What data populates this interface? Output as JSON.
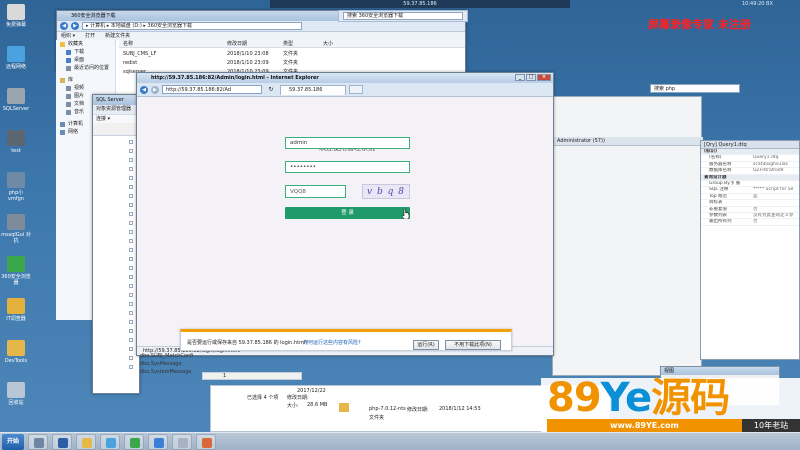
{
  "desktop": {
    "top_title": "59.37.85.186",
    "top_right": "10:49:20 BX",
    "watermark": "屏幕录像专家 未注册",
    "icons": [
      {
        "label": "免费弹幕",
        "color": "#d9d9d9"
      },
      {
        "label": "远程网络",
        "color": "#4aa3df"
      },
      {
        "label": "SQLServer",
        "color": "#9aa4ae"
      },
      {
        "label": "test",
        "color": "#5c6670"
      },
      {
        "label": "php小vmfgn",
        "color": "#6e8aa7"
      },
      {
        "label": "mssqlGui 对抗",
        "color": "#7c8c9b"
      },
      {
        "label": "360安全浏览器",
        "color": "#3aa84a"
      },
      {
        "label": "IT调查器",
        "color": "#e3b23c"
      },
      {
        "label": "DevTools",
        "color": "#e5b649"
      },
      {
        "label": "回收站",
        "color": "#b8c6d6"
      }
    ]
  },
  "explorer": {
    "title": "360安全浏览器下载",
    "address": "▸ 计算机 ▸ 本地磁盘 (D:) ▸ 360安全浏览器下载",
    "search": "搜索 360安全浏览器下载",
    "menu": [
      "组织 ▾",
      "打开",
      "新建文件夹"
    ],
    "columns": [
      "名称",
      "修改日期",
      "类型",
      "大小"
    ],
    "nav": [
      {
        "label": "收藏夹",
        "color": "#f0c040",
        "sub": false
      },
      {
        "label": "下载",
        "color": "#4a7fc7",
        "sub": true
      },
      {
        "label": "桌面",
        "color": "#4a7fc7",
        "sub": true
      },
      {
        "label": "最近访问的位置",
        "color": "#7a8fa5",
        "sub": true
      },
      {
        "label": "库",
        "color": "#d8b35a",
        "sub": false
      },
      {
        "label": "视频",
        "color": "#7a8fa5",
        "sub": true
      },
      {
        "label": "图片",
        "color": "#7a8fa5",
        "sub": true
      },
      {
        "label": "文档",
        "color": "#7a8fa5",
        "sub": true
      },
      {
        "label": "音乐",
        "color": "#7a8fa5",
        "sub": true
      },
      {
        "label": "计算机",
        "color": "#6b8db5",
        "sub": false
      },
      {
        "label": "网络",
        "color": "#6b8db5",
        "sub": false
      }
    ],
    "files": [
      {
        "name": "SUBJ_CMS_LF",
        "date": "2018/1/10 23:08",
        "type": "文件夹",
        "size": ""
      },
      {
        "name": "redist",
        "date": "2018/1/10 23:09",
        "type": "文件夹",
        "size": ""
      },
      {
        "name": "sqlserver",
        "date": "2018/1/10 23:09",
        "type": "文件夹",
        "size": ""
      }
    ]
  },
  "ie": {
    "title": "http://59.37.85.186:82/Admin/login.html - Internet Explorer",
    "url": "http://59.37.85.186:82/Ad",
    "tab": "59.37.85.186",
    "status_url": "http://59.37.85.186:82/login/login.html",
    "search_placeholder": "搜索 php"
  },
  "login": {
    "title": "欢迎使用管理系统",
    "username": "admin",
    "password": "••••••••",
    "captcha_input": "VQQ8",
    "captcha_image": "v b q 8",
    "button": "登 录"
  },
  "notification": {
    "text": "是否要运行或保存来自 59.37.85.186 的 login.html?",
    "link": "为何运行这些内容有风险?",
    "run": "运行(R)",
    "save": "不用下载此项(N)"
  },
  "sql": {
    "title": "SQL Server",
    "toolbar": "对象资源管理器",
    "connect": "连接 ▾",
    "mid_bar": "Administrator (57))",
    "db_rows": [
      "dbo.SUBJ_MatchConfi",
      "dbo.SysMessage",
      "dbo.SystemMessage"
    ],
    "pager": "1"
  },
  "properties": {
    "header": "[Qry] Query1.dtq",
    "rows": [
      {
        "k": "(标识)",
        "v": "",
        "cat": true
      },
      {
        "k": "(名称)",
        "v": "Query1.dtq",
        "cat": false
      },
      {
        "k": "服务器名称",
        "v": "scat\\bsighe1las",
        "cat": false
      },
      {
        "k": "数据库名称",
        "v": "QZFRtrafrod9",
        "cat": false
      },
      {
        "k": "查询设计器",
        "v": "",
        "cat": true
      },
      {
        "k": "Group By 扩展",
        "v": "",
        "cat": false
      },
      {
        "k": "SQL 注释",
        "v": "***** Script for Se",
        "cat": false
      },
      {
        "k": "Top 规范",
        "v": "是",
        "cat": false
      },
      {
        "k": "目标表",
        "v": "",
        "cat": false
      },
      {
        "k": "非重复值",
        "v": "否",
        "cat": false
      },
      {
        "k": "参数列表",
        "v": "没有为此查询定义参",
        "cat": false
      },
      {
        "k": "输出所有列",
        "v": "否",
        "cat": false
      }
    ]
  },
  "bottom_explorer": {
    "selected": "已选择 4 个项",
    "date_label": "修改日期:",
    "date_value": "2017/12/22",
    "size_label": "大小:",
    "size_value": "28.6 MB",
    "file_name": "php-7.0.12-nts",
    "file_date_label": "修改日期:",
    "file_date": "2018/1/12 14:53",
    "file_type": "文件夹"
  },
  "mini_panel": {
    "title": "视图"
  },
  "logo": {
    "brand_prefix": "89",
    "brand_ye": "Ye",
    "brand_cn": "源码",
    "url": "www.89YE.com",
    "tag": "10年老站"
  },
  "taskbar": {
    "start": "开始",
    "items": [
      {
        "name": "server-manager",
        "color": "#6f86a3"
      },
      {
        "name": "powershell",
        "color": "#2c5ea8"
      },
      {
        "name": "explorer",
        "color": "#e6b84a"
      },
      {
        "name": "network",
        "color": "#4aa3df"
      },
      {
        "name": "browser",
        "color": "#3aa84a"
      },
      {
        "name": "ie",
        "color": "#3b7fd6"
      },
      {
        "name": "sql",
        "color": "#a7b3c0"
      },
      {
        "name": "tool",
        "color": "#d86a3a"
      }
    ]
  }
}
